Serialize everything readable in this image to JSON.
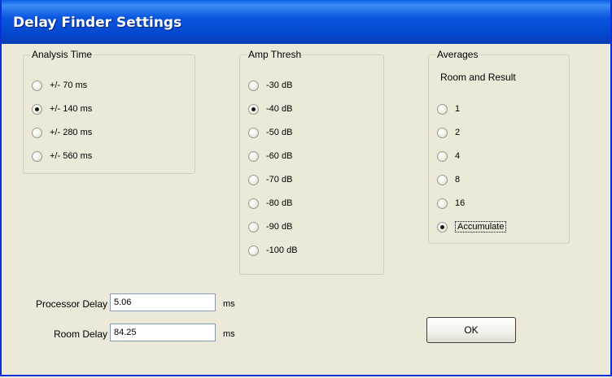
{
  "window": {
    "title": "Delay Finder Settings"
  },
  "analysis_time": {
    "legend": "Analysis Time",
    "selected_index": 1,
    "options": [
      "+/- 70 ms",
      "+/- 140 ms",
      "+/- 280 ms",
      "+/- 560 ms"
    ]
  },
  "amp_thresh": {
    "legend": "Amp Thresh",
    "selected_index": 1,
    "options": [
      "-30 dB",
      "-40 dB",
      "-50 dB",
      "-60 dB",
      "-70 dB",
      "-80 dB",
      "-90 dB",
      "-100 dB"
    ]
  },
  "averages": {
    "legend": "Averages",
    "caption": "Room and Result",
    "selected_index": 5,
    "options": [
      "1",
      "2",
      "4",
      "8",
      "16",
      "Accumulate"
    ]
  },
  "delays": {
    "processor_label": "Processor Delay",
    "processor_value": "5.06",
    "processor_unit": "ms",
    "room_label": "Room Delay",
    "room_value": "84.25",
    "room_unit": "ms"
  },
  "buttons": {
    "ok_label": "OK"
  },
  "colors": {
    "titlebar": "#0a56e0",
    "dialog_bg": "#ece9d8",
    "textbox_border": "#7f9db9"
  }
}
